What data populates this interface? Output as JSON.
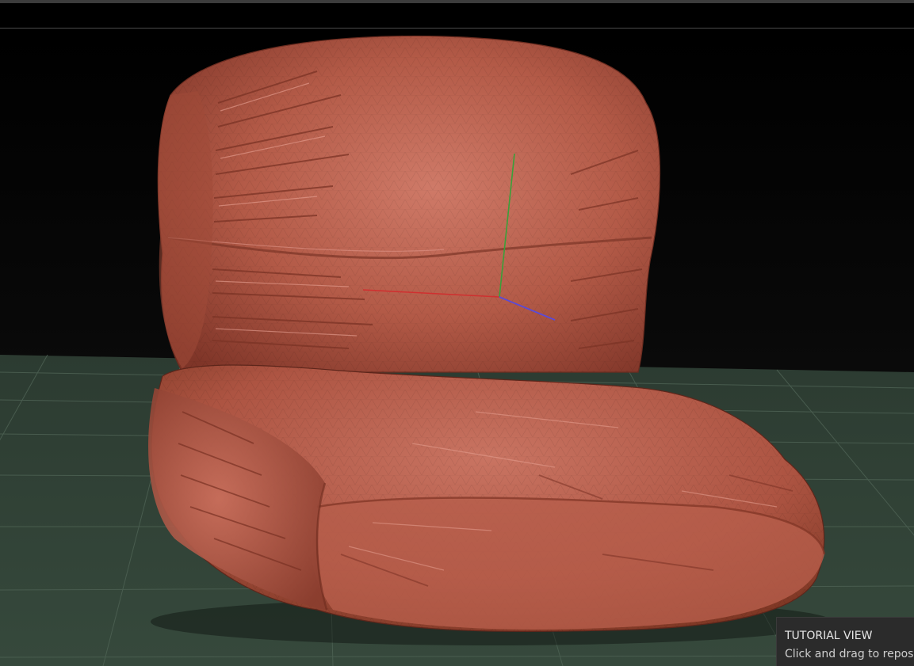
{
  "tooltip": {
    "title": "TUTORIAL VIEW",
    "body": "Click and drag to reposi"
  },
  "scene": {
    "object": "puffy lounge chair mesh",
    "material_color": "#b85a48",
    "floor_color": "#33453a",
    "grid_color": "#4d6153",
    "axis_x_color": "#d03030",
    "axis_y_color": "#3aa03a",
    "axis_z_color": "#5a4ad8"
  }
}
